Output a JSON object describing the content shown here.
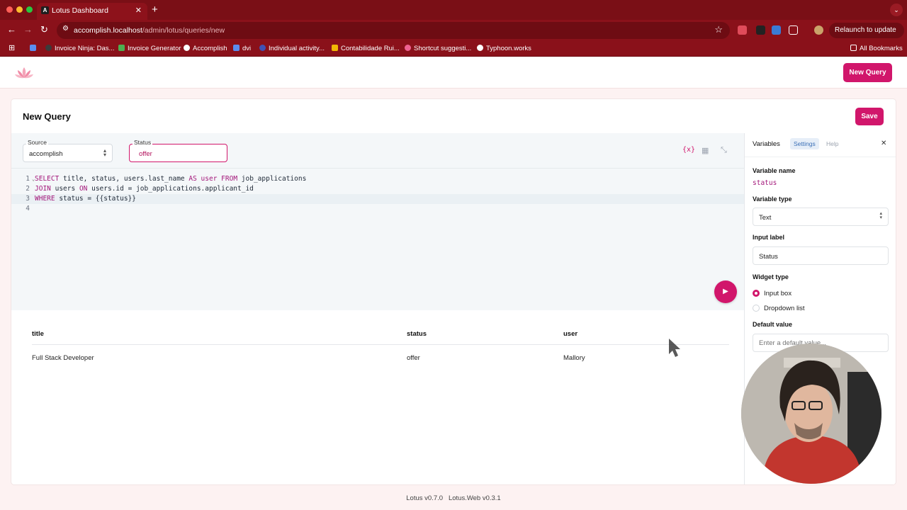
{
  "browser": {
    "tab_title": "Lotus Dashboard",
    "tab_favicon": "A",
    "url_host": "accomplish.localhost",
    "url_path": "/admin/lotus/queries/new",
    "relaunch_label": "Relaunch to update",
    "bookmarks": [
      {
        "label": "Invoice Ninja: Das...",
        "color": "#3b3b3b"
      },
      {
        "label": "Invoice Generator",
        "color": "#4caf50"
      },
      {
        "label": "Accomplish",
        "color": "#333333"
      },
      {
        "label": "dvi",
        "color": "#5b8def"
      },
      {
        "label": "Individual activity...",
        "color": "#3f51b5"
      },
      {
        "label": "Contabilidade Rui...",
        "color": "#f2b705"
      },
      {
        "label": "Shortcut suggesti...",
        "color": "#f06292"
      },
      {
        "label": "Typhoon.works",
        "color": "#222222"
      }
    ],
    "all_bookmarks": "All Bookmarks"
  },
  "app": {
    "new_query_button": "New Query",
    "page_title": "New Query",
    "save_button": "Save"
  },
  "params": {
    "source_label": "Source",
    "source_value": "accomplish",
    "status_label": "Status",
    "status_value": "offer"
  },
  "editor": {
    "icons": [
      "variables-icon",
      "table-icon",
      "collapse-icon"
    ],
    "lines": [
      {
        "num": "1",
        "tokens": [
          {
            "t": "SELECT",
            "k": true
          },
          {
            "t": " title, status, users.last_name ",
            "k": false
          },
          {
            "t": "AS",
            "k": true
          },
          {
            "t": " ",
            "k": false
          },
          {
            "t": "user",
            "k": true
          },
          {
            "t": " ",
            "k": false
          },
          {
            "t": "FROM",
            "k": true
          },
          {
            "t": " job_applications",
            "k": false
          }
        ]
      },
      {
        "num": "2",
        "tokens": [
          {
            "t": "JOIN",
            "k": true
          },
          {
            "t": " users ",
            "k": false
          },
          {
            "t": "ON",
            "k": true
          },
          {
            "t": " users.id = job_applications.applicant_id",
            "k": false
          }
        ]
      },
      {
        "num": "3",
        "tokens": [
          {
            "t": "WHERE",
            "k": true
          },
          {
            "t": " status = {{status}}",
            "k": false
          }
        ]
      },
      {
        "num": "4",
        "tokens": []
      }
    ]
  },
  "results": {
    "columns": [
      "title",
      "status",
      "user"
    ],
    "rows": [
      [
        "Full Stack Developer",
        "offer",
        "Mallory"
      ]
    ]
  },
  "panel": {
    "tabs": [
      "Variables",
      "Settings",
      "Help"
    ],
    "variable_name_label": "Variable name",
    "variable_name_value": "status",
    "variable_type_label": "Variable type",
    "variable_type_value": "Text",
    "input_label_label": "Input label",
    "input_label_value": "Status",
    "widget_type_label": "Widget type",
    "widget_options": [
      "Input box",
      "Dropdown list"
    ],
    "widget_selected": "Input box",
    "default_value_label": "Default value",
    "default_value_placeholder": "Enter a default value..."
  },
  "footer": {
    "version": "Lotus v0.7.0",
    "web_version": "Lotus.Web v0.3.1"
  },
  "colors": {
    "accent": "#d1166b",
    "browser_frame": "#8a111a",
    "keyword": "#a3177a"
  }
}
